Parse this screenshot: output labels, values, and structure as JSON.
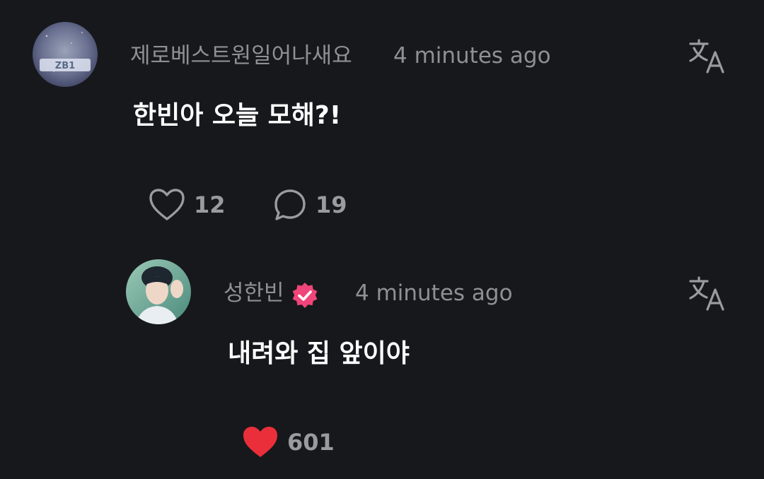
{
  "comments": [
    {
      "username": "제로베스트원일어나새요",
      "time": "4 minutes ago",
      "text": "한빈아 오늘 모해?!",
      "likes": "12",
      "replies": "19",
      "liked": false
    },
    {
      "username": "성한빈",
      "verified": true,
      "time": "4 minutes ago",
      "text": "내려와 집 앞이야",
      "likes": "601",
      "liked": true
    }
  ],
  "icons": {
    "translate": "translate-icon",
    "like": "heart-icon",
    "reply": "comment-bubble-icon",
    "verified": "verified-badge-icon"
  },
  "colors": {
    "background": "#17181c",
    "muted_text": "#8f8f96",
    "primary_text": "#ffffff",
    "liked_heart": "#ea2f3a",
    "verified_badge": "#f0457a"
  }
}
